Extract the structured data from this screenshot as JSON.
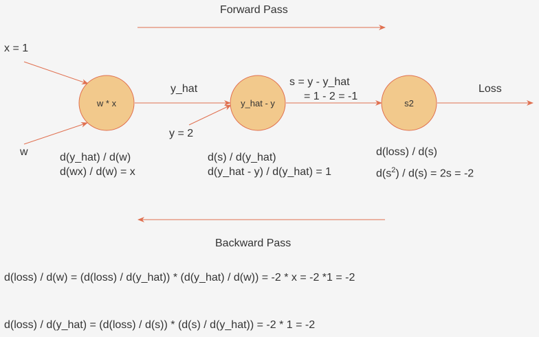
{
  "colors": {
    "background": "#f5f5f5",
    "node_fill": "#f2c98c",
    "node_stroke": "#e07050",
    "arrow": "#e07050",
    "text": "#333333"
  },
  "headers": {
    "forward_pass": "Forward Pass",
    "backward_pass": "Backward Pass"
  },
  "inputs": {
    "x": "x = 1",
    "w": "w",
    "y": "y = 2"
  },
  "nodes": {
    "mul": "w * x",
    "sub": "y_hat - y",
    "sq": "s2"
  },
  "edges": {
    "y_hat": "y_hat",
    "s_line1": "s  = y - y_hat",
    "s_line2": "= 1 - 2 = -1",
    "loss": "Loss"
  },
  "gradients": {
    "mul_line1": "d(y_hat) / d(w)",
    "mul_line2": "d(wx) / d(w) = x",
    "sub_line1": "d(s) / d(y_hat)",
    "sub_line2": "d(y_hat - y) / d(y_hat) = 1",
    "sq_line1": "d(loss) / d(s)",
    "sq_line2_pre": "d(s",
    "sq_line2_sup": "2",
    "sq_line2_post": ") / d(s) = 2s = -2"
  },
  "equations": {
    "eq1": "d(loss) / d(w) = (d(loss) / d(y_hat)) * (d(y_hat) / d(w)) =  -2 * x = -2 *1 = -2",
    "eq2": "d(loss) / d(y_hat) = (d(loss) / d(s)) * (d(s) / d(y_hat)) = -2 * 1 = -2"
  }
}
